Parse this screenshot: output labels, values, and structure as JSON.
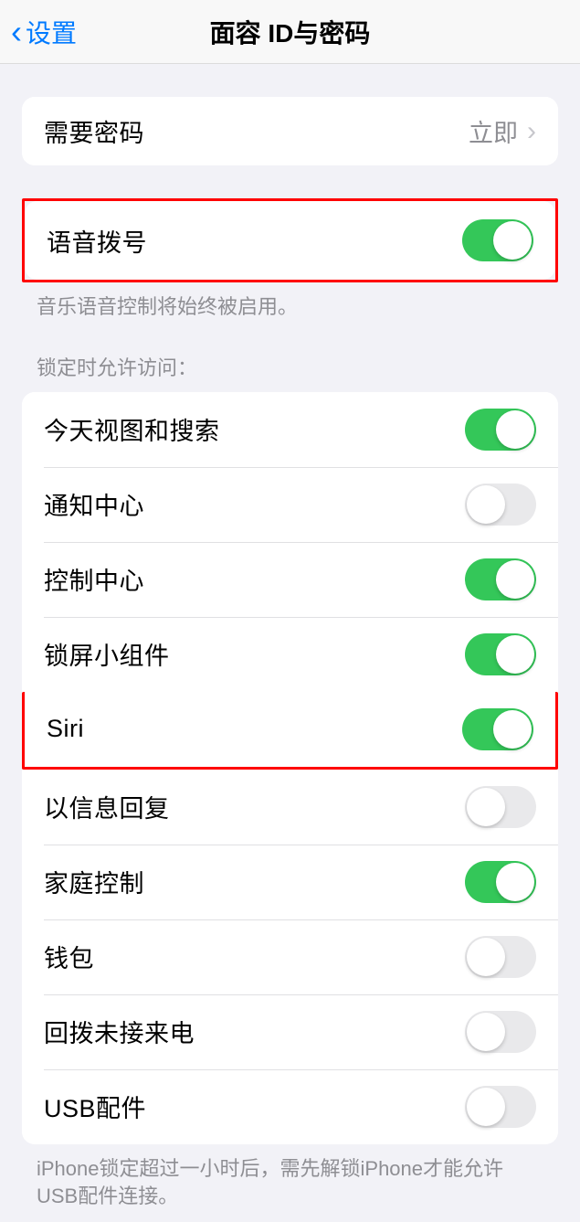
{
  "header": {
    "back_label": "设置",
    "title": "面容 ID与密码"
  },
  "require_passcode": {
    "label": "需要密码",
    "value": "立即"
  },
  "voice_dial": {
    "label": "语音拨号",
    "enabled": true,
    "footer": "音乐语音控制将始终被启用。"
  },
  "lock_access": {
    "header": "锁定时允许访问：",
    "items": [
      {
        "label": "今天视图和搜索",
        "enabled": true
      },
      {
        "label": "通知中心",
        "enabled": false
      },
      {
        "label": "控制中心",
        "enabled": true
      },
      {
        "label": "锁屏小组件",
        "enabled": true
      },
      {
        "label": "Siri",
        "enabled": true
      },
      {
        "label": "以信息回复",
        "enabled": false
      },
      {
        "label": "家庭控制",
        "enabled": true
      },
      {
        "label": "钱包",
        "enabled": false
      },
      {
        "label": "回拨未接来电",
        "enabled": false
      },
      {
        "label": "USB配件",
        "enabled": false
      }
    ],
    "footer": "iPhone锁定超过一小时后，需先解锁iPhone才能允许USB配件连接。"
  }
}
